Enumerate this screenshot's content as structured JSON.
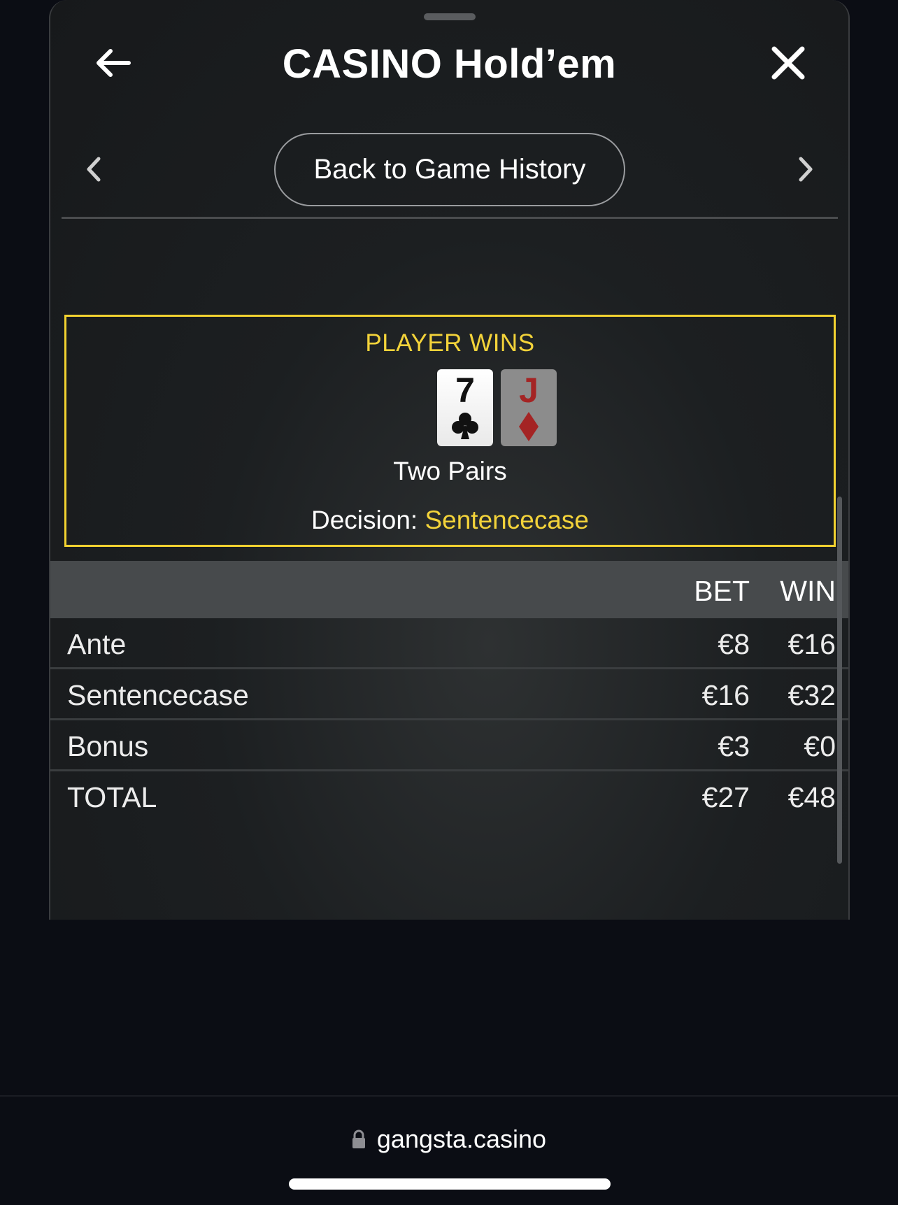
{
  "header": {
    "title": "CASINO Hold’em",
    "back_icon": "arrow-left-icon",
    "close_icon": "close-icon"
  },
  "nav": {
    "prev_icon": "chevron-left-icon",
    "next_icon": "chevron-right-icon",
    "history_button_label": "Back to Game History"
  },
  "result": {
    "heading": "PLAYER WINS",
    "cards": [
      {
        "rank": "7",
        "suit": "clubs",
        "suit_glyph": "♣"
      },
      {
        "rank": "J",
        "suit": "diamonds",
        "suit_glyph": "♦"
      }
    ],
    "hand_name": "Two Pairs",
    "decision_label": "Decision:",
    "decision_value": "Sentencecase"
  },
  "table": {
    "headers": {
      "bet": "BET",
      "win": "WIN"
    },
    "rows": [
      {
        "label": "Ante",
        "bet": "€8",
        "win": "€16"
      },
      {
        "label": "Sentencecase",
        "bet": "€16",
        "win": "€32"
      },
      {
        "label": "Bonus",
        "bet": "€3",
        "win": "€0"
      },
      {
        "label": "TOTAL",
        "bet": "€27",
        "win": "€48"
      }
    ]
  },
  "browser": {
    "url": "gangsta.casino",
    "lock_icon": "lock-icon"
  },
  "colors": {
    "accent_yellow": "#f2d230",
    "background": "#0b0d14",
    "panel": "#1c1f21",
    "card_red": "#a42424"
  }
}
